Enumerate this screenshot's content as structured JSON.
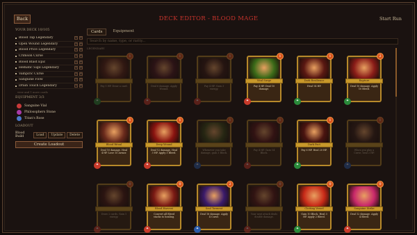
{
  "header": {
    "back_label": "Back",
    "title": "DECK EDITOR - BLOOD MAGE",
    "start_label": "Start Run"
  },
  "sidebar": {
    "deck_title": "YOUR DECK 10/105",
    "cards": [
      {
        "label": "Blood Tap Legendary"
      },
      {
        "label": "Open Wound Legendary"
      },
      {
        "label": "Blood Price Legendary"
      },
      {
        "label": "Crimson Curse"
      },
      {
        "label": "Blood Blast Epic"
      },
      {
        "label": "Hematic Sigil Legendary"
      },
      {
        "label": "Vampiric Curse"
      },
      {
        "label": "Sanguine Flow"
      },
      {
        "label": "Drain Touch Legendary"
      }
    ],
    "more_label": "view and 1 more cards",
    "equipment_title": "EQUIPMENT 3/3",
    "equipment": [
      {
        "label": "Sanguine Vial",
        "color": "#c83a3a"
      },
      {
        "label": "Philosophers Stone",
        "color": "#a83aa8"
      },
      {
        "label": "Titan's Rose",
        "color": "#4a78c8"
      }
    ],
    "loadout_title": "LOADOUT",
    "loadout_name": "Blood Build",
    "load_label": "Load",
    "update_label": "Update",
    "delete_label": "Delete",
    "create_label": "Create Loadout"
  },
  "main": {
    "tabs": [
      {
        "label": "Cards"
      },
      {
        "label": "Equipment"
      }
    ],
    "search_placeholder": "Search by name, type, or rarity...",
    "section_label": "LEGENDARY",
    "cards": [
      {
        "name": "",
        "cost": "1",
        "desc": "Pay 1 HP. Draw a card.",
        "dim": true,
        "art": "#5a2418",
        "type": "green"
      },
      {
        "name": "",
        "cost": "1",
        "desc": "Deal 6 damage. Apply Wound.",
        "dim": true,
        "art": "#4a1620",
        "type": "red"
      },
      {
        "name": "",
        "cost": "1",
        "desc": "Pay 4 HP. Gain 3 energy.",
        "dim": true,
        "art": "#3a1a14",
        "type": "red"
      },
      {
        "name": "Vital Surge",
        "cost": "1",
        "desc": "Pay 4 HP. Deal 10 damage.",
        "dim": false,
        "art": "#3a6a18",
        "type": "red"
      },
      {
        "name": "Dark Resilience",
        "cost": "1",
        "desc": "Heal 14 HP.",
        "dim": false,
        "art": "#5a1812",
        "type": "green"
      },
      {
        "name": "Rapture",
        "cost": "2",
        "desc": "Deal 10 damage. Apply 10 Bleed.",
        "dim": false,
        "art": "#8a1c18",
        "type": "green"
      },
      {
        "name": "Blood Ritual",
        "cost": "1",
        "desc": "Deal 10 damage. Heal 4 HP. Lose 15 Armor.",
        "dim": false,
        "art": "#6a2a1c",
        "type": "red"
      },
      {
        "name": "Deep Wound",
        "cost": "1",
        "desc": "Deal 12 damage. Heal 3 HP. Apply 3 Bleed.",
        "dim": false,
        "art": "#8a1410",
        "type": "red"
      },
      {
        "name": "",
        "cost": "1",
        "desc": "Whenever you take damage, gain 3 Block.",
        "dim": true,
        "art": "#3a4a18",
        "type": "blue"
      },
      {
        "name": "",
        "cost": "1",
        "desc": "Pay 4 HP. Gain 14 Block.",
        "dim": true,
        "art": "#5a1418",
        "type": "red"
      },
      {
        "name": "Dark Pact",
        "cost": "1",
        "desc": "Pay 6 HP. Heal 20 HP.",
        "dim": false,
        "art": "#4a1410",
        "type": "green"
      },
      {
        "name": "",
        "cost": "1",
        "desc": "When you play a Curse, heal 2 HP.",
        "dim": true,
        "art": "#3a2018",
        "type": "blue"
      },
      {
        "name": "",
        "cost": "0",
        "desc": "Draw 2 cards. Gain 1 energy.",
        "dim": true,
        "art": "#4a1a14",
        "type": "red"
      },
      {
        "name": "Blood Harvest",
        "cost": "0",
        "desc": "Convert all Bleed stacks to healing.",
        "dim": false,
        "art": "#7a1a14",
        "type": "red"
      },
      {
        "name": "Soul Torment",
        "cost": "2",
        "desc": "Deal 18 damage. Apply 4 Curse.",
        "dim": false,
        "art": "#3a1a6a",
        "type": "blue"
      },
      {
        "name": "",
        "cost": "0",
        "desc": "Your next attack deals double damage.",
        "dim": true,
        "art": "#5a1818",
        "type": "red"
      },
      {
        "name": "Clotting Vessel",
        "cost": "0",
        "desc": "Gain 10 Block. Heal 3 HP. Apply 2 Bleed.",
        "dim": false,
        "art": "#c82a18",
        "type": "green"
      },
      {
        "name": "Sanguine Strike",
        "cost": "0",
        "desc": "Deal 12 damage. Apply 4 Bleed.",
        "dim": false,
        "art": "#c8286a",
        "type": "red"
      }
    ]
  }
}
